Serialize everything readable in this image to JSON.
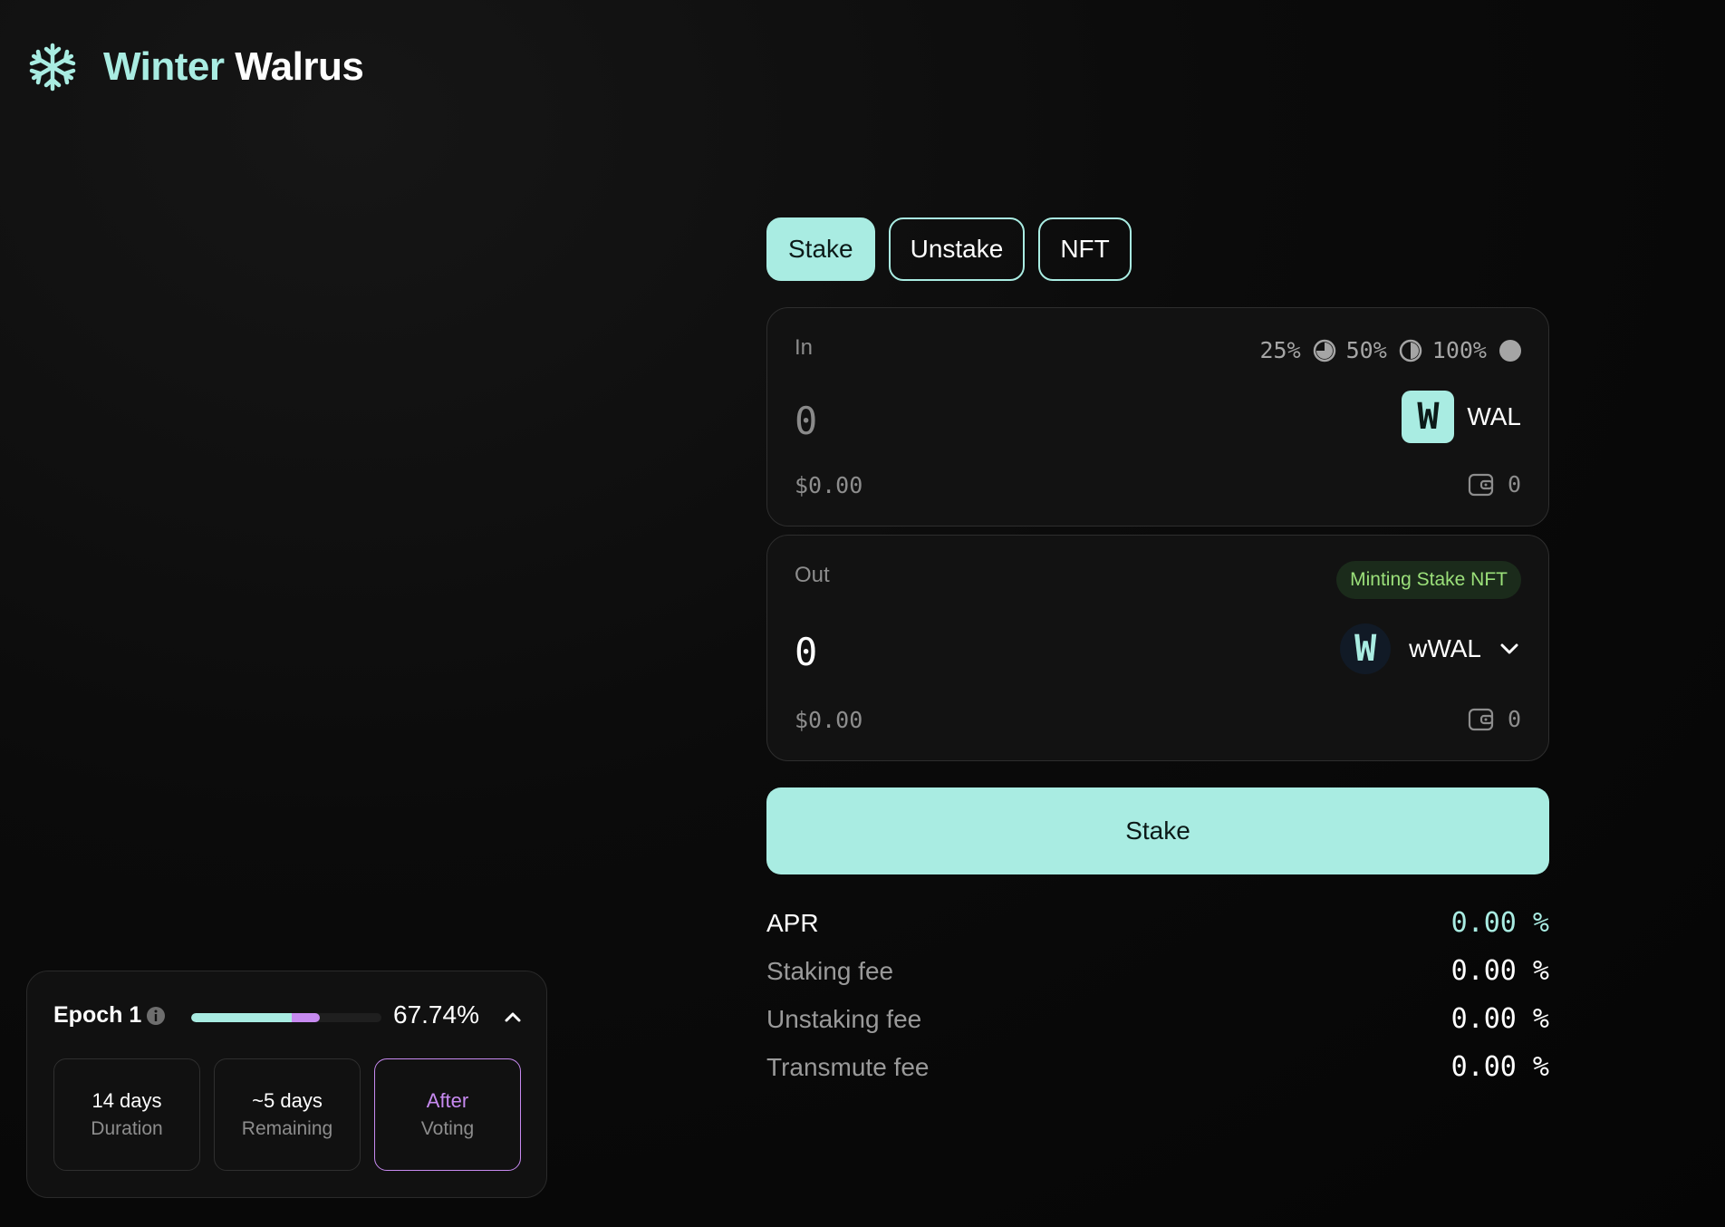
{
  "brand": {
    "name_first": "Winter",
    "name_second": "Walrus",
    "logo_icon": "snowflake-icon"
  },
  "tabs": [
    {
      "label": "Stake",
      "active": true
    },
    {
      "label": "Unstake",
      "active": false
    },
    {
      "label": "NFT",
      "active": false
    }
  ],
  "input_card": {
    "label": "In",
    "quick_amounts": [
      "25%",
      "50%",
      "100%"
    ],
    "amount": "0",
    "usd_value": "$0.00",
    "token": {
      "symbol": "WAL",
      "logo_letter": "W"
    },
    "balance": "0"
  },
  "output_card": {
    "label": "Out",
    "badge": "Minting Stake NFT",
    "amount": "0",
    "usd_value": "$0.00",
    "token": {
      "symbol": "wWAL",
      "logo_letter": "W"
    },
    "balance": "0"
  },
  "action": {
    "stake_label": "Stake"
  },
  "stats": [
    {
      "label": "APR",
      "value": "0.00 %"
    },
    {
      "label": "Staking fee",
      "value": "0.00 %"
    },
    {
      "label": "Unstaking fee",
      "value": "0.00 %"
    },
    {
      "label": "Transmute fee",
      "value": "0.00 %"
    }
  ],
  "epoch": {
    "title": "Epoch 1",
    "progress_percent": "67.74%",
    "progress_fraction": 0.6774,
    "boxes": [
      {
        "value": "14 days",
        "label": "Duration"
      },
      {
        "value": "~5 days",
        "label": "Remaining"
      },
      {
        "value": "After",
        "label": "Voting"
      }
    ]
  },
  "colors": {
    "accent": "#a9ece2",
    "accent_purple": "#c78af0",
    "badge_green": "#9be07a",
    "background": "#0b0b0b",
    "card": "#121212"
  }
}
